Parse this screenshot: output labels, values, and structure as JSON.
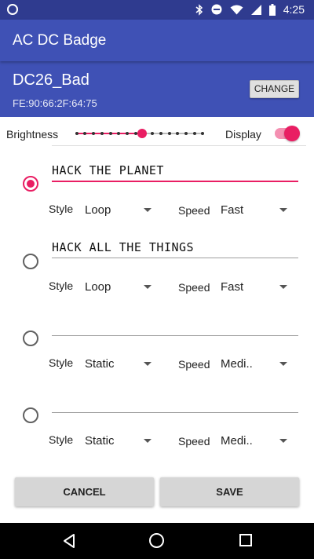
{
  "status_bar": {
    "time": "4:25"
  },
  "app": {
    "title": "AC DC Badge"
  },
  "device": {
    "name": "DC26_Bad",
    "mac": "FE:90:66:2F:64:75",
    "change_label": "CHANGE"
  },
  "controls": {
    "brightness_label": "Brightness",
    "brightness_level": 0.54,
    "display_label": "Display",
    "display_on": true
  },
  "messages": [
    {
      "text": "HACK THE PLANET",
      "selected": true,
      "style_label": "Style",
      "style_value": "Loop",
      "speed_label": "Speed",
      "speed_value": "Fast"
    },
    {
      "text": "HACK ALL THE THINGS",
      "selected": false,
      "style_label": "Style",
      "style_value": "Loop",
      "speed_label": "Speed",
      "speed_value": "Fast"
    },
    {
      "text": "",
      "selected": false,
      "style_label": "Style",
      "style_value": "Static",
      "speed_label": "Speed",
      "speed_value": "Medi.."
    },
    {
      "text": "",
      "selected": false,
      "style_label": "Style",
      "style_value": "Static",
      "speed_label": "Speed",
      "speed_value": "Medi.."
    }
  ],
  "actions": {
    "cancel_label": "CANCEL",
    "save_label": "SAVE"
  },
  "colors": {
    "primary": "#3f51b5",
    "primary_dark": "#2f3b8f",
    "accent": "#e91e63"
  },
  "icons": {
    "status": [
      "notification-dot-icon",
      "bluetooth-icon",
      "do-not-disturb-icon",
      "wifi-icon",
      "cellular-icon",
      "battery-icon"
    ],
    "nav": [
      "back-icon",
      "home-icon",
      "recents-icon"
    ]
  }
}
